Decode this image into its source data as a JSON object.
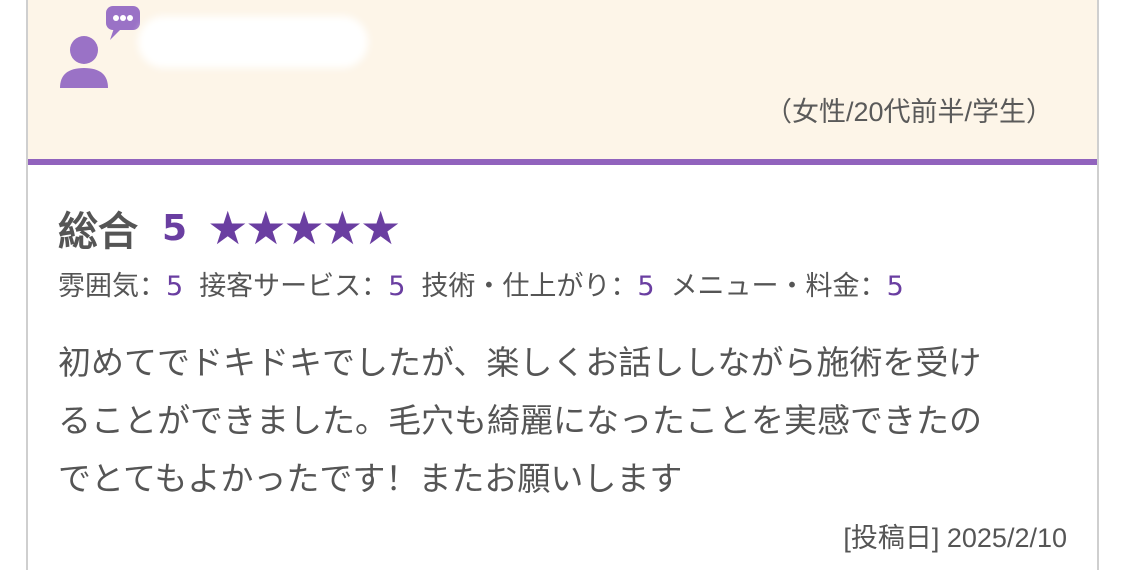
{
  "reviewer": {
    "profile": "（女性/20代前半/学生）"
  },
  "rating": {
    "overall_label": "総合",
    "overall_score": "5",
    "stars": "★★★★★",
    "star_count": 5,
    "items": [
      {
        "label": "雰囲気：",
        "value": "5"
      },
      {
        "label": "接客サービス：",
        "value": "5"
      },
      {
        "label": "技術・仕上がり：",
        "value": "5"
      },
      {
        "label": "メニュー・料金：",
        "value": "5"
      }
    ]
  },
  "comment": {
    "lines": [
      "初めてでドキドキでしたが、楽しくお話ししながら施術を受け",
      "ることができました。毛穴も綺麗になったことを実感できたの",
      "でとてもよかったです！またお願いします"
    ]
  },
  "post_date": "[投稿日] 2025/2/10",
  "colors": {
    "accent": "#6a3ea1",
    "header_bg": "#fdf5e8",
    "divider": "#9163bd",
    "text": "#555555"
  }
}
